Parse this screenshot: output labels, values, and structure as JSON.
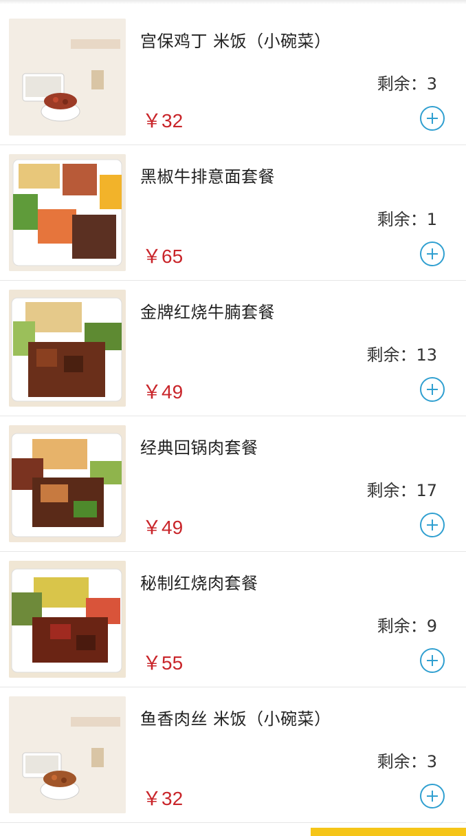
{
  "stock_label": "剩余：",
  "currency": "￥",
  "items": [
    {
      "name": "宫保鸡丁 米饭（小碗菜）",
      "stock": "3",
      "price": "32",
      "image": "kungpao-rice-photo"
    },
    {
      "name": "黑椒牛排意面套餐",
      "stock": "1",
      "price": "65",
      "image": "black-pepper-steak-pasta-photo"
    },
    {
      "name": "金牌红烧牛腩套餐",
      "stock": "13",
      "price": "49",
      "image": "braised-beef-brisket-photo"
    },
    {
      "name": "经典回锅肉套餐",
      "stock": "17",
      "price": "49",
      "image": "twice-cooked-pork-photo"
    },
    {
      "name": "秘制红烧肉套餐",
      "stock": "9",
      "price": "55",
      "image": "braised-pork-photo"
    },
    {
      "name": "鱼香肉丝 米饭（小碗菜）",
      "stock": "3",
      "price": "32",
      "image": "yuxiang-pork-rice-photo"
    }
  ],
  "colors": {
    "price": "#c9252a",
    "add_button": "#2f9fd0",
    "bottom_bar": "#f5c518"
  }
}
